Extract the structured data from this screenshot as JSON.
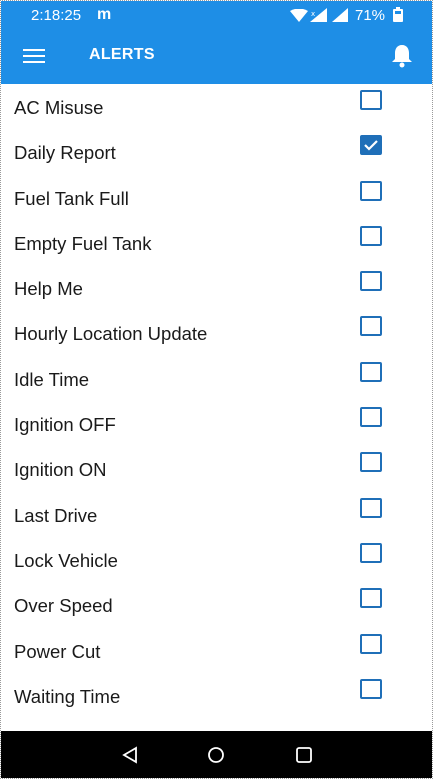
{
  "status_bar": {
    "time": "2:18:25",
    "app_indicator": "m",
    "battery": "71%",
    "icons": [
      "wifi-icon",
      "signal-icon",
      "battery-icon"
    ]
  },
  "app_bar": {
    "title": "ALERTS",
    "left_icon": "menu-icon",
    "right_icon": "bell-icon",
    "background": "#1e8ee6"
  },
  "alerts": [
    {
      "label": "AC Misuse",
      "checked": false
    },
    {
      "label": "Daily Report",
      "checked": true
    },
    {
      "label": "Fuel Tank Full",
      "checked": false
    },
    {
      "label": "Empty Fuel Tank",
      "checked": false
    },
    {
      "label": "Help Me",
      "checked": false
    },
    {
      "label": "Hourly Location Update",
      "checked": false
    },
    {
      "label": "Idle Time",
      "checked": false
    },
    {
      "label": "Ignition OFF",
      "checked": false
    },
    {
      "label": "Ignition ON",
      "checked": false
    },
    {
      "label": "Last Drive",
      "checked": false
    },
    {
      "label": "Lock Vehicle",
      "checked": false
    },
    {
      "label": "Over Speed",
      "checked": false
    },
    {
      "label": "Power Cut",
      "checked": false
    },
    {
      "label": "Waiting Time",
      "checked": false
    }
  ],
  "nav_bar": {
    "buttons": [
      "back-icon",
      "home-icon",
      "recents-icon"
    ]
  },
  "colors": {
    "accent": "#1e8ee6",
    "checkbox": "#1f6fb8"
  }
}
